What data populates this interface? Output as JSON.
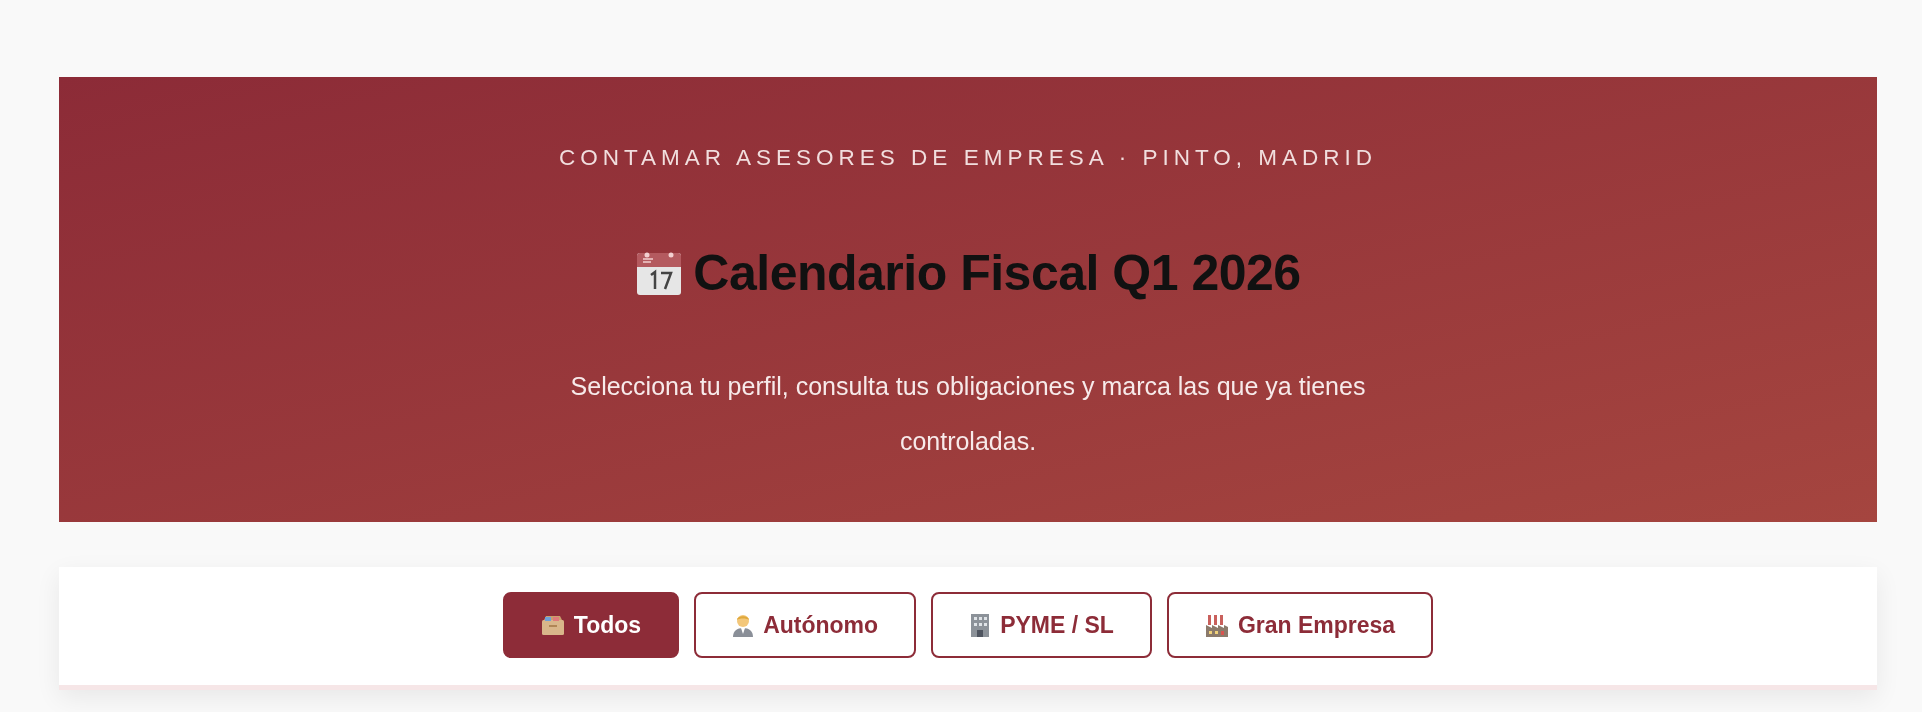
{
  "hero": {
    "eyebrow": "CONTAMAR ASESORES DE EMPRESA · PINTO, MADRID",
    "title": "Calendario Fiscal Q1 2026",
    "description": "Selecciona tu perfil, consulta tus obligaciones y marca las que ya tienes controladas."
  },
  "profile_filters": [
    {
      "label": "Todos",
      "kind": "all",
      "selected": true
    },
    {
      "label": "Autónomo",
      "kind": "freelancer",
      "selected": false
    },
    {
      "label": "PYME / SL",
      "kind": "sme",
      "selected": false
    },
    {
      "label": "Gran Empresa",
      "kind": "enterprise",
      "selected": false
    }
  ]
}
